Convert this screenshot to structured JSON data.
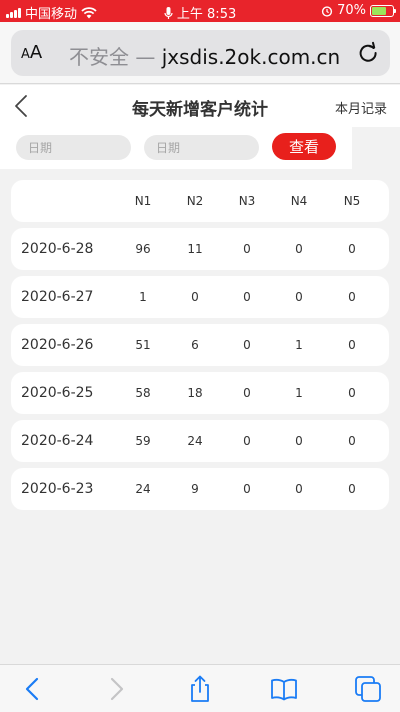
{
  "status": {
    "carrier": "中国移动",
    "time": "上午 8:53",
    "battery": "70%"
  },
  "browser": {
    "aa_big": "A",
    "aa_small": "A",
    "insecure": "不安全 — ",
    "domain": "jxsdis.2ok.com.cn"
  },
  "header": {
    "title": "每天新增客户统计",
    "month_link": "本月记录"
  },
  "filter": {
    "date_placeholder_1": "日期",
    "date_placeholder_2": "日期",
    "view_label": "查看"
  },
  "table": {
    "columns": [
      "N1",
      "N2",
      "N3",
      "N4",
      "N5"
    ],
    "rows": [
      {
        "date": "2020-6-28",
        "values": [
          "96",
          "11",
          "0",
          "0",
          "0"
        ]
      },
      {
        "date": "2020-6-27",
        "values": [
          "1",
          "0",
          "0",
          "0",
          "0"
        ]
      },
      {
        "date": "2020-6-26",
        "values": [
          "51",
          "6",
          "0",
          "1",
          "0"
        ]
      },
      {
        "date": "2020-6-25",
        "values": [
          "58",
          "18",
          "0",
          "1",
          "0"
        ]
      },
      {
        "date": "2020-6-24",
        "values": [
          "59",
          "24",
          "0",
          "0",
          "0"
        ]
      },
      {
        "date": "2020-6-23",
        "values": [
          "24",
          "9",
          "0",
          "0",
          "0"
        ]
      }
    ]
  },
  "colors": {
    "status_bar": "#e8242b",
    "accent": "#e8201c",
    "ios_blue": "#1a7cf5"
  }
}
